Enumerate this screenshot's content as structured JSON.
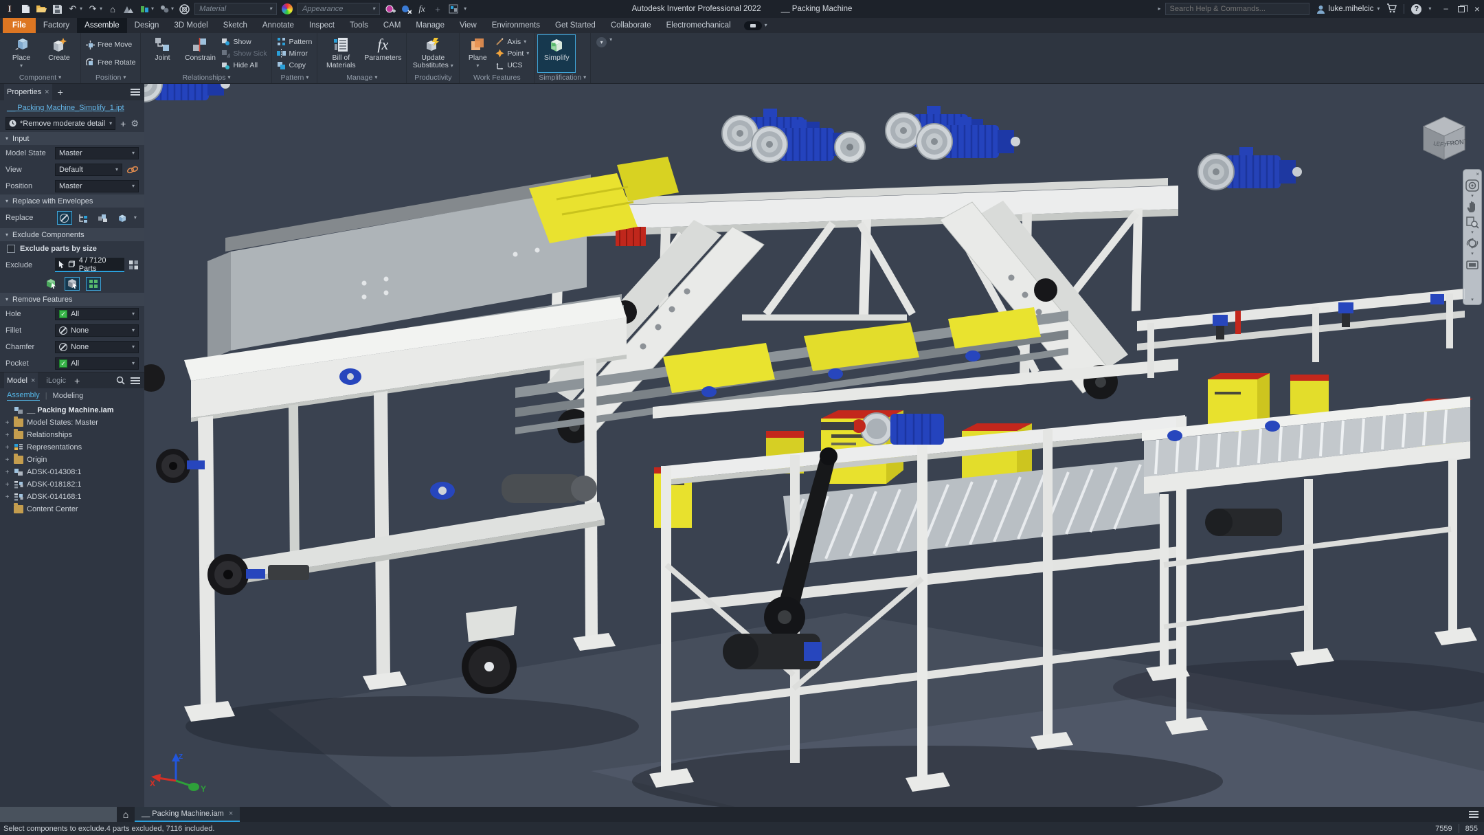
{
  "titlebar": {
    "app_title": "Autodesk Inventor Professional 2022",
    "doc_title": "__ Packing Machine",
    "search_placeholder": "Search Help & Commands...",
    "user_name": "luke.mihelcic",
    "material_label": "Material",
    "appearance_label": "Appearance"
  },
  "ribbon_tabs": {
    "items": [
      {
        "label": "File"
      },
      {
        "label": "Factory"
      },
      {
        "label": "Assemble"
      },
      {
        "label": "Design"
      },
      {
        "label": "3D Model"
      },
      {
        "label": "Sketch"
      },
      {
        "label": "Annotate"
      },
      {
        "label": "Inspect"
      },
      {
        "label": "Tools"
      },
      {
        "label": "CAM"
      },
      {
        "label": "Manage"
      },
      {
        "label": "View"
      },
      {
        "label": "Environments"
      },
      {
        "label": "Get Started"
      },
      {
        "label": "Collaborate"
      },
      {
        "label": "Electromechanical"
      }
    ],
    "active_tab": "Assemble"
  },
  "ribbon": {
    "component": {
      "label": "Component",
      "place": "Place",
      "create": "Create"
    },
    "position": {
      "label": "Position",
      "free_move": "Free Move",
      "free_rotate": "Free Rotate"
    },
    "relationships": {
      "label": "Relationships",
      "joint": "Joint",
      "constrain": "Constrain",
      "show": "Show",
      "show_sick": "Show Sick",
      "hide_all": "Hide All"
    },
    "pattern": {
      "label": "Pattern",
      "pattern": "Pattern",
      "mirror": "Mirror",
      "copy": "Copy"
    },
    "manage": {
      "label": "Manage",
      "bom": "Bill of Materials",
      "parameters": "Parameters"
    },
    "productivity": {
      "label": "Productivity",
      "update_substitutes": "Update Substitutes"
    },
    "work_features": {
      "label": "Work Features",
      "plane": "Plane",
      "axis": "Axis",
      "point": "Point",
      "ucs": "UCS"
    },
    "simplification": {
      "label": "Simplification",
      "simplify": "Simplify"
    }
  },
  "properties_panel": {
    "tab_label": "Properties",
    "document_link": "__ Packing Machine_Simplify_1.ipt",
    "preset_value": "*Remove moderate detail (l",
    "input_section": {
      "title": "Input",
      "rows": [
        {
          "label": "Model State",
          "value": "Master"
        },
        {
          "label": "View",
          "value": "Default"
        },
        {
          "label": "Position",
          "value": "Master"
        }
      ]
    },
    "replace_section": {
      "title": "Replace with Envelopes",
      "row_label": "Replace"
    },
    "exclude_section": {
      "title": "Exclude Components",
      "checkbox_label": "Exclude parts by size",
      "row_label": "Exclude",
      "value": "4 / 7120 Parts"
    },
    "remove_features_section": {
      "title": "Remove Features",
      "rows": [
        {
          "label": "Hole",
          "value": "All",
          "mode": "check"
        },
        {
          "label": "Fillet",
          "value": "None",
          "mode": "none"
        },
        {
          "label": "Chamfer",
          "value": "None",
          "mode": "none"
        },
        {
          "label": "Pocket",
          "value": "All",
          "mode": "check"
        }
      ]
    }
  },
  "model_panel": {
    "tab_model": "Model",
    "tab_ilogic": "iLogic",
    "subtab_assembly": "Assembly",
    "subtab_modeling": "Modeling",
    "tree": [
      {
        "label": "__ Packing Machine.iam",
        "icon": "assembly-icon"
      },
      {
        "label": "Model States: Master",
        "icon": "folder-icon"
      },
      {
        "label": "Relationships",
        "icon": "folder-icon"
      },
      {
        "label": "Representations",
        "icon": "representations-icon"
      },
      {
        "label": "Origin",
        "icon": "folder-icon"
      },
      {
        "label": "ADSK-014308:1",
        "icon": "part-icon"
      },
      {
        "label": "ADSK-018182:1",
        "icon": "pattern-part-icon"
      },
      {
        "label": "ADSK-014168:1",
        "icon": "pattern-part-icon"
      },
      {
        "label": "Content Center",
        "icon": "folder-icon"
      }
    ]
  },
  "viewport": {
    "viewcube": {
      "front": "FRONT",
      "left": "LEFT"
    },
    "triad": {
      "x": "X",
      "y": "Y",
      "z": "Z"
    }
  },
  "document_tabs": {
    "active": "__ Packing Machine.iam"
  },
  "status_bar": {
    "message": "Select components to exclude.4 parts excluded, 7116 included.",
    "counter_left": "7559",
    "counter_right": "855"
  },
  "icons": {
    "chevron_down": "▾",
    "expander": "+",
    "close": "×",
    "home": "⌂",
    "undo": "↶",
    "redo": "↷",
    "minimize": "–",
    "help": "?",
    "plus": "+",
    "gear": "⚙",
    "search_arrow": "▸",
    "divider": "|",
    "check": "✓"
  },
  "colors": {
    "accent": "#2aa0dc",
    "file_tab_orange": "#dd7622",
    "link_blue": "#64b5e6",
    "motor_blue": "#2443bd",
    "box_yellow": "#e7e02c",
    "viewport_bg": "#3a4250"
  }
}
